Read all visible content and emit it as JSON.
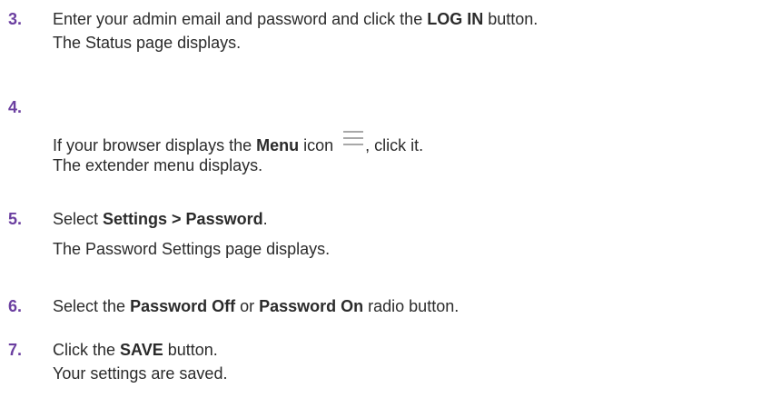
{
  "theme": {
    "step_number_color": "#6b3fa0",
    "text_color": "#2b2b2b"
  },
  "steps": [
    {
      "number": "3.",
      "line1": {
        "pre": "Enter your admin email and password and click the ",
        "bold": "LOG IN",
        "post": " button."
      },
      "line2": "The Status page displays."
    },
    {
      "number": "4.",
      "line1": {
        "pre": "If your browser displays the ",
        "bold": "Menu",
        "mid": " icon ",
        "icon": "hamburger-menu-icon",
        "post": ", click it."
      },
      "line2": "The extender menu displays."
    },
    {
      "number": "5.",
      "line1": {
        "pre": "Select ",
        "bold": "Settings > Password",
        "post": "."
      },
      "line2": "The Password Settings page displays."
    },
    {
      "number": "6.",
      "line1": {
        "pre": "Select the ",
        "bold": "Password Off",
        "mid": " or ",
        "bold2": "Password On",
        "post": " radio button."
      }
    },
    {
      "number": "7.",
      "line1": {
        "pre": "Click the ",
        "bold": "SAVE",
        "post": " button."
      },
      "line2": "Your settings are saved."
    }
  ]
}
